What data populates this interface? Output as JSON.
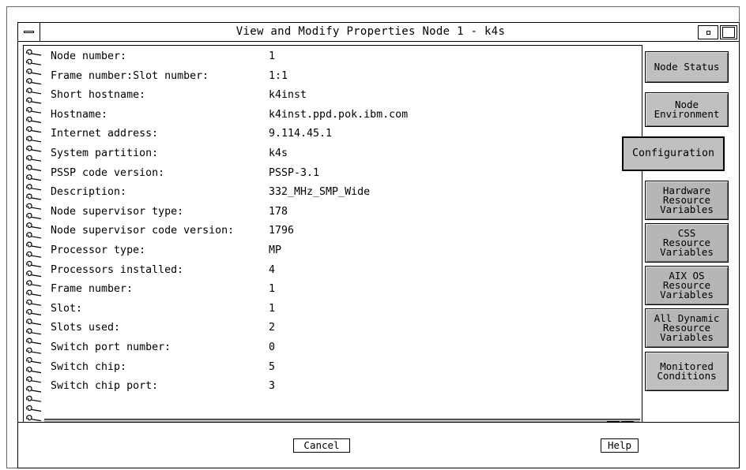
{
  "window": {
    "title": "View and Modify Properties Node 1 - k4s"
  },
  "properties": [
    {
      "label": "Node number:",
      "value": "1"
    },
    {
      "label": "Frame number:Slot number:",
      "value": "1:1"
    },
    {
      "label": "Short hostname:",
      "value": "k4inst"
    },
    {
      "label": "Hostname:",
      "value": "k4inst.ppd.pok.ibm.com"
    },
    {
      "label": "Internet address:",
      "value": "9.114.45.1"
    },
    {
      "label": "System partition:",
      "value": "k4s"
    },
    {
      "label": "PSSP code version:",
      "value": "PSSP-3.1"
    },
    {
      "label": "Description:",
      "value": "332_MHz_SMP_Wide"
    },
    {
      "label": "Node supervisor type:",
      "value": "178"
    },
    {
      "label": "Node supervisor code version:",
      "value": "1796"
    },
    {
      "label": "Processor type:",
      "value": "MP"
    },
    {
      "label": "Processors installed:",
      "value": "4"
    },
    {
      "label": "Frame number:",
      "value": "1"
    },
    {
      "label": "Slot:",
      "value": "1"
    },
    {
      "label": "Slots used:",
      "value": "2"
    },
    {
      "label": "Switch port number:",
      "value": "0"
    },
    {
      "label": "Switch chip:",
      "value": "5"
    },
    {
      "label": "Switch chip port:",
      "value": "3"
    }
  ],
  "tabs": [
    {
      "label": "Node Status",
      "active": false
    },
    {
      "label": "Node\nEnvironment",
      "active": false
    },
    {
      "label": "Configuration",
      "active": true
    },
    {
      "label": "Hardware\nResource\nVariables",
      "active": false
    },
    {
      "label": "CSS\nResource\nVariables",
      "active": false
    },
    {
      "label": "AIX OS\nResource\nVariables",
      "active": false
    },
    {
      "label": "All Dynamic\nResource\nVariables",
      "active": false
    },
    {
      "label": "Monitored\nConditions",
      "active": false
    }
  ],
  "buttons": {
    "cancel": "Cancel",
    "help": "Help"
  },
  "icons": {
    "system_menu": "system-menu-icon",
    "minimize": "minimize-icon",
    "maximize": "maximize-icon",
    "scroll_left": "scroll-left-arrow-icon",
    "scroll_right": "scroll-right-arrow-icon",
    "spiral": "spiral-binding-icon"
  }
}
